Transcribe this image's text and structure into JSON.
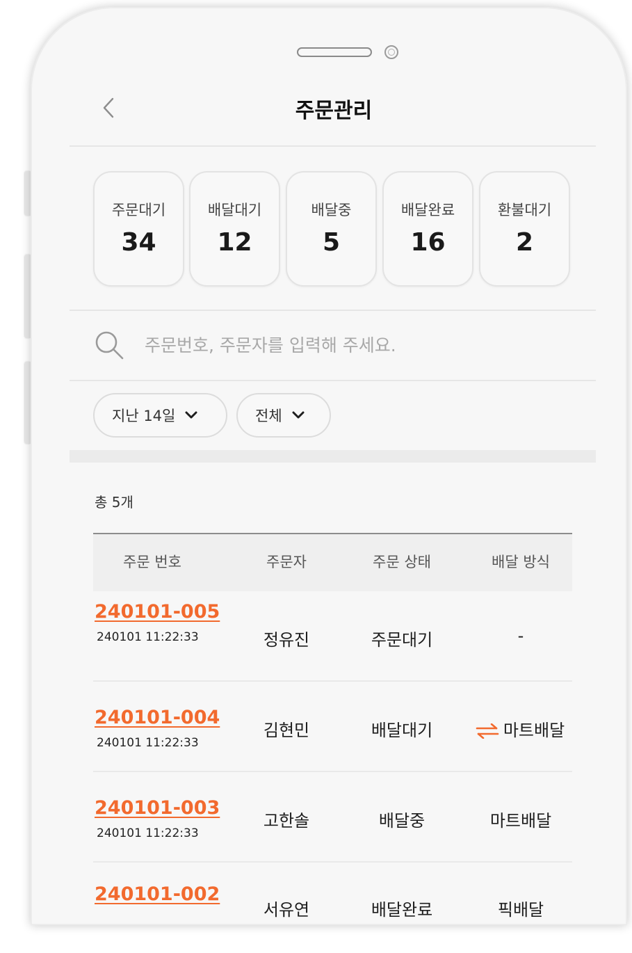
{
  "header": {
    "title": "주문관리",
    "back_icon": "chevron-left-icon"
  },
  "summary": [
    {
      "label": "주문대기",
      "value": "34"
    },
    {
      "label": "배달대기",
      "value": "12"
    },
    {
      "label": "배달중",
      "value": "5"
    },
    {
      "label": "배달완료",
      "value": "16"
    },
    {
      "label": "환불대기",
      "value": "2"
    }
  ],
  "search": {
    "placeholder": "주문번호, 주문자를 입력해 주세요.",
    "value": "",
    "icon": "search-icon"
  },
  "filters": [
    {
      "label": "지난 14일",
      "icon": "chevron-down-icon"
    },
    {
      "label": "전체",
      "icon": "chevron-down-icon"
    }
  ],
  "total": "총 5개",
  "table": {
    "columns": [
      "주문 번호",
      "주문자",
      "주문 상태",
      "배달 방식"
    ],
    "rows": [
      {
        "order_no": "240101-005",
        "time": "240101 11:22:33",
        "customer": "정유진",
        "status": "주문대기",
        "delivery": "-"
      },
      {
        "order_no": "240101-004",
        "time": "240101 11:22:33",
        "customer": "김현민",
        "status": "배달대기",
        "delivery": "마트배달",
        "delivery_icon": "swap-arrows-icon"
      },
      {
        "order_no": "240101-003",
        "time": "240101 11:22:33",
        "customer": "고한솔",
        "status": "배달중",
        "delivery": "마트배달"
      },
      {
        "order_no": "240101-002",
        "time": "",
        "customer": "서유연",
        "status": "배달완료",
        "delivery": "픽배달"
      }
    ]
  },
  "colors": {
    "accent": "#f26a2e",
    "card_border": "#e3e3e3",
    "divider": "#e6e6e6"
  }
}
